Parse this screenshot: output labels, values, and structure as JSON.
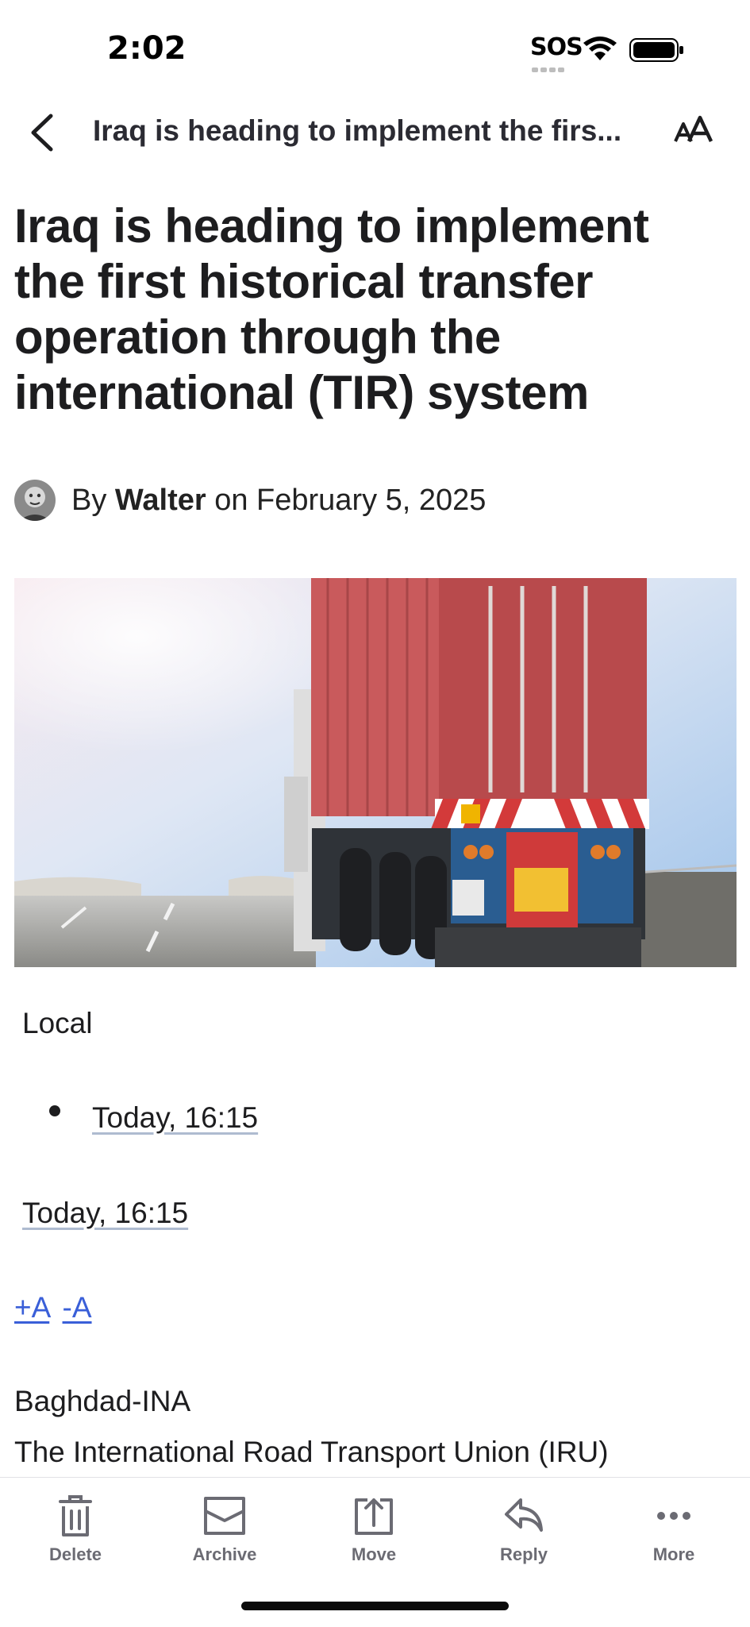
{
  "status": {
    "time": "2:02",
    "sos": "SOS"
  },
  "nav": {
    "title": "Iraq is heading to implement the firs..."
  },
  "article": {
    "headline": "Iraq is heading to implement the first historical transfer operation through the international (TIR) system",
    "byline": {
      "prefix": "By",
      "author": "Walter",
      "date_text": "on February 5, 2025"
    },
    "category": "Local",
    "bullet_time": "Today, 16:15",
    "time_link": "Today, 16:15",
    "font_increase": "+A",
    "font_decrease": "-A",
    "dateline": "Baghdad-INA",
    "first_paragraph": "The International Road Transport Union (IRU)"
  },
  "toolbar": {
    "delete": "Delete",
    "archive": "Archive",
    "move": "Move",
    "reply": "Reply",
    "more": "More"
  },
  "colors": {
    "link_blue": "#3a5fd8",
    "icon_gray": "#6b6b73",
    "text": "#1d1d1f"
  }
}
